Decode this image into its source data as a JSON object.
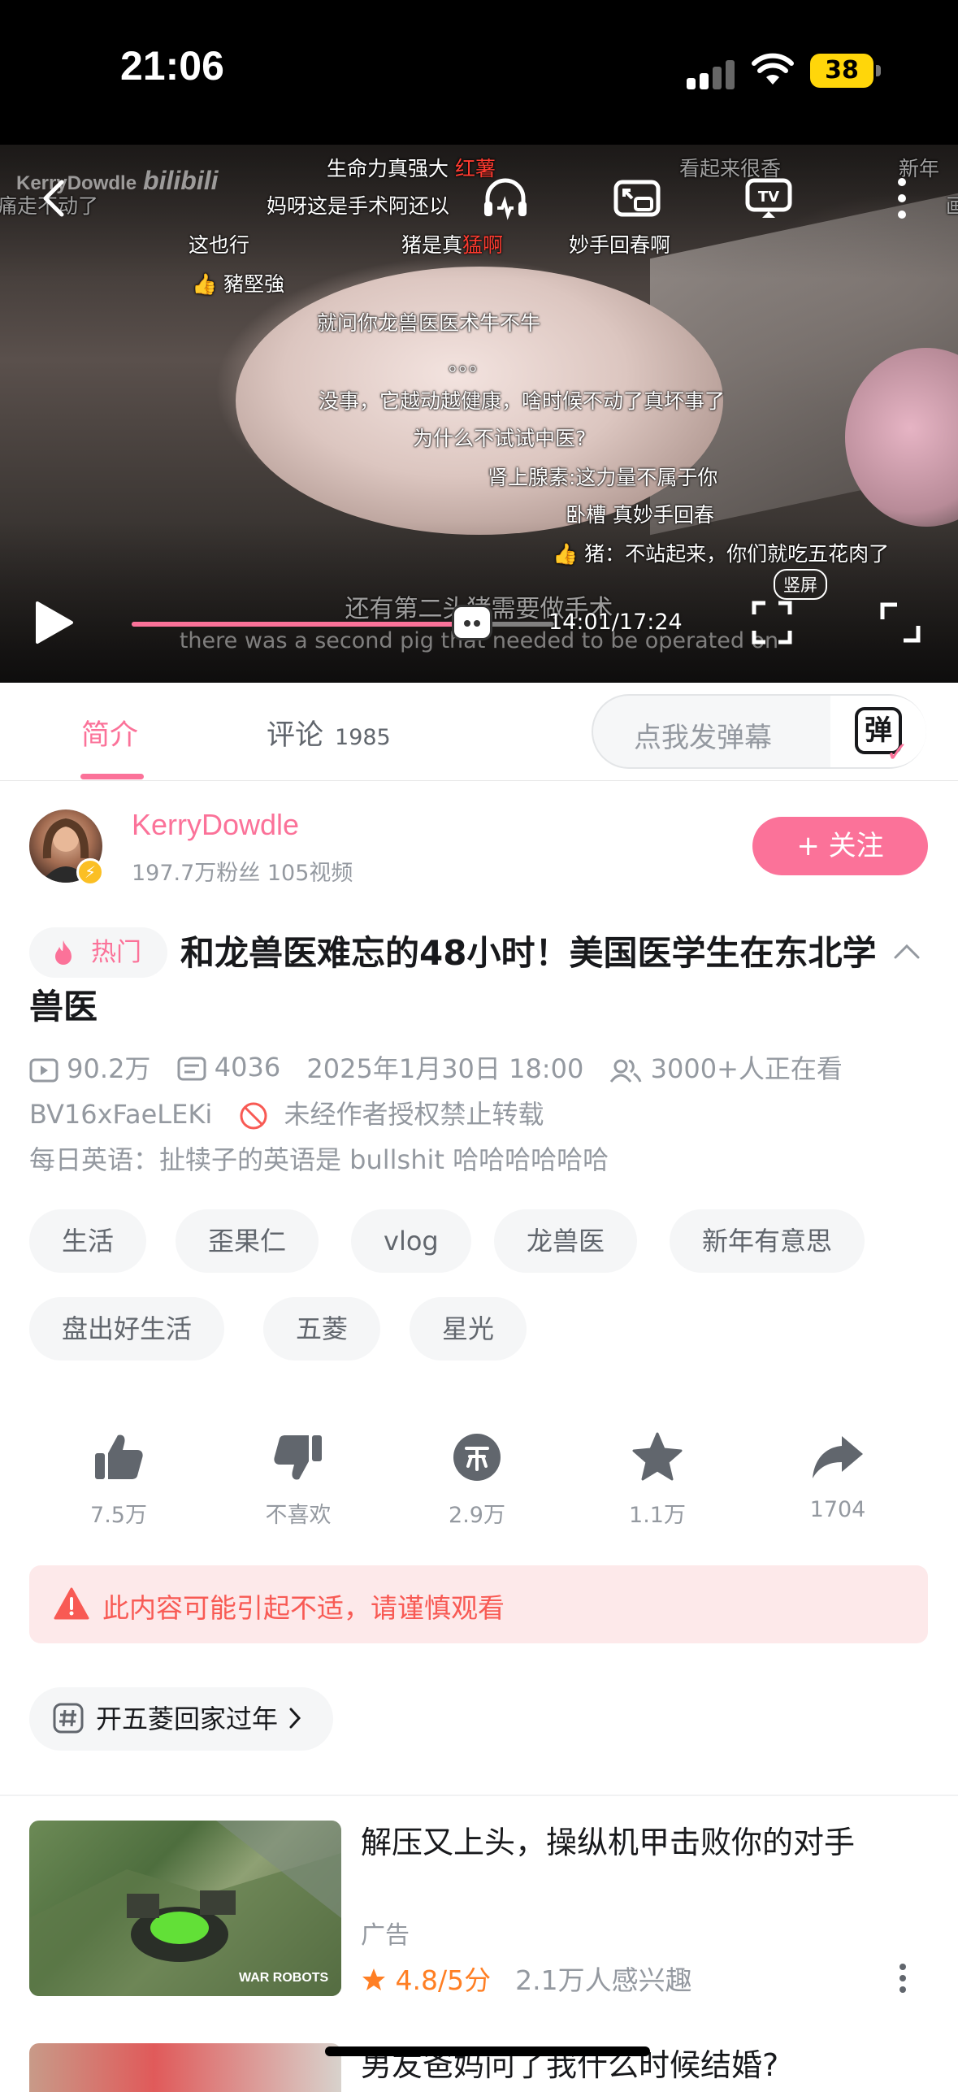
{
  "status_bar": {
    "time": "21:06",
    "battery": "38"
  },
  "video": {
    "watermark": "KerryDowdle",
    "watermark_logo": "bilibili",
    "danmaku": [
      {
        "text_pre": "生命力真强大 ",
        "text_red": "红薯",
        "text_post": ""
      },
      {
        "text_pre": "看起来很香",
        "text_red": "",
        "text_post": ""
      },
      {
        "text_pre": "新年",
        "text_red": "",
        "text_post": ""
      },
      {
        "text_pre": "痛走不动了",
        "text_red": "",
        "text_post": ""
      },
      {
        "text_pre": "妈呀这是手术阿还以",
        "text_red": "",
        "text_post": ""
      },
      {
        "text_pre": "画",
        "text_red": "",
        "text_post": ""
      },
      {
        "text_pre": "这也行",
        "text_red": "",
        "text_post": ""
      },
      {
        "text_pre": "猪是真",
        "text_red": "猛啊",
        "text_post": ""
      },
      {
        "text_pre": "妙手回春啊",
        "text_red": "",
        "text_post": ""
      },
      {
        "text_pre": "👍 豬堅強",
        "text_red": "",
        "text_post": ""
      },
      {
        "text_pre": "就问你龙兽医医术牛不牛",
        "text_red": "",
        "text_post": ""
      },
      {
        "text_pre": "。。。",
        "text_red": "",
        "text_post": ""
      },
      {
        "text_pre": "没事，它越动越健康，啥时候不动了真坏事了",
        "text_red": "",
        "text_post": ""
      },
      {
        "text_pre": "为什么不试试中医?",
        "text_red": "",
        "text_post": ""
      },
      {
        "text_pre": "肾上腺素:这力量不属于你",
        "text_red": "",
        "text_post": ""
      },
      {
        "text_pre": "卧槽 真妙手回春",
        "text_red": "",
        "text_post": ""
      },
      {
        "text_pre": "👍 猪：不站起来，你们就吃五花肉了",
        "text_red": "",
        "text_post": ""
      }
    ],
    "subtitle_cn": "还有第二头猪需要做手术",
    "subtitle_en": "there was a second pig that needed to be operated on",
    "time_display": "14:01/17:24",
    "progress": 0.806,
    "vertical_label": "竖屏"
  },
  "tabs": {
    "intro": "简介",
    "comments": "评论",
    "comments_count": "1985",
    "danmu_placeholder": "点我发弹幕",
    "danmu_icon_char": "弹"
  },
  "uploader": {
    "name": "KerryDowdle",
    "stats": "197.7万粉丝  105视频",
    "follow_label": "+ 关注"
  },
  "video_info": {
    "hot_tag": "热门",
    "title": "和龙兽医难忘的48小时！美国医学生在东北学兽医",
    "views": "90.2万",
    "danmaku_count": "4036",
    "date": "2025年1月30日 18:00",
    "watching": "3000+人正在看",
    "bvid": "BV16xFaeLEKi",
    "copyright": "未经作者授权禁止转载",
    "description": "每日英语：扯犊子的英语是 bullshit 哈哈哈哈哈哈"
  },
  "tags": [
    "生活",
    "歪果仁",
    "vlog",
    "龙兽医",
    "新年有意思",
    "盘出好生活",
    "五菱",
    "星光"
  ],
  "actions": {
    "like": "7.5万",
    "dislike": "不喜欢",
    "coin": "2.9万",
    "favorite": "1.1万",
    "share": "1704"
  },
  "warning": "此内容可能引起不适，请谨慎观看",
  "topic": "开五菱回家过年",
  "recommendations": [
    {
      "title": "解压又上头，操纵机甲击败你的对手",
      "label": "广告",
      "rating": "4.8/5分",
      "interested": "2.1万人感兴趣",
      "thumb_text": "WAR ROBOTS"
    },
    {
      "title": "男友爸妈问了我什么时候结婚?"
    }
  ]
}
